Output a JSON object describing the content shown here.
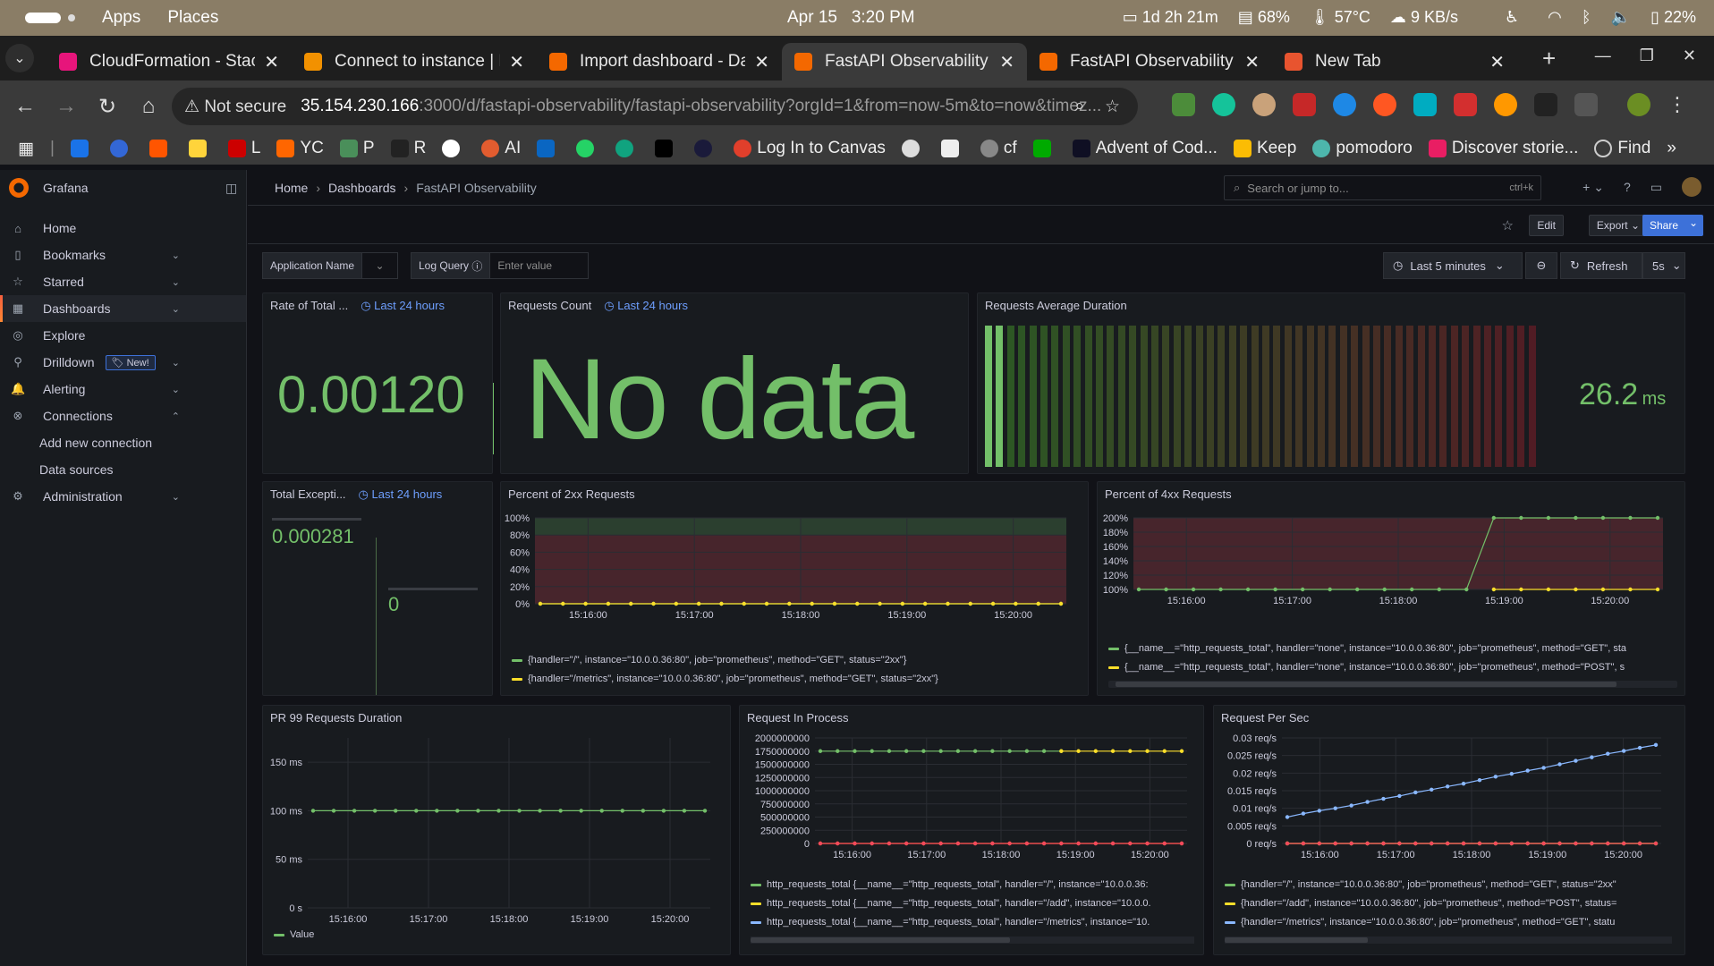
{
  "os": {
    "apps": "Apps",
    "places": "Places",
    "date": "Apr 15",
    "time": "3:20 PM",
    "uptime": "1d 2h 21m",
    "mem": "68%",
    "temp": "57°C",
    "net": "9 KB/s",
    "battery": "22%"
  },
  "browser": {
    "tabs": [
      {
        "title": "CloudFormation - Stac",
        "color": "#e7157b"
      },
      {
        "title": "Connect to instance | E",
        "color": "#f29100"
      },
      {
        "title": "Import dashboard - Da",
        "color": "#f46800"
      },
      {
        "title": "FastAPI Observability",
        "color": "#f46800",
        "active": true
      },
      {
        "title": "FastAPI Observability",
        "color": "#f46800"
      },
      {
        "title": "New Tab",
        "color": "#e8542f"
      }
    ],
    "not_secure": "Not secure",
    "url_host": "35.154.230.166",
    "url_rest": ":3000/d/fastapi-observability/fastapi-observability?orgId=1&from=now-5m&to=now&timez...",
    "bookmarks": [
      "L",
      "YC",
      "P",
      "R",
      "AI",
      "Log In to Canvas",
      "cf",
      "Advent of Cod...",
      "Keep",
      "pomodoro",
      "Discover storie...",
      "Find"
    ]
  },
  "grafana": {
    "app_name": "Grafana",
    "nav": {
      "home": "Home",
      "bookmarks": "Bookmarks",
      "starred": "Starred",
      "dashboards": "Dashboards",
      "explore": "Explore",
      "drilldown": "Drilldown",
      "new_badge": "New!",
      "alerting": "Alerting",
      "connections": "Connections",
      "add_new_connection": "Add new connection",
      "data_sources": "Data sources",
      "administration": "Administration"
    },
    "breadcrumb": {
      "home": "Home",
      "dashboards": "Dashboards",
      "current": "FastAPI Observability"
    },
    "search_placeholder": "Search or jump to...",
    "search_shortcut": "ctrl+k",
    "actions": {
      "edit": "Edit",
      "export": "Export",
      "share": "Share"
    },
    "vars": {
      "app_name_label": "Application Name",
      "log_query_label": "Log Query",
      "log_query_placeholder": "Enter value"
    },
    "time_picker": "Last 5 minutes",
    "refresh": "Refresh",
    "refresh_interval": "5s"
  },
  "panels": {
    "rate_total": {
      "title": "Rate of Total ...",
      "time": "Last 24 hours",
      "value": "0.00120"
    },
    "requests_count": {
      "title": "Requests Count",
      "time": "Last 24 hours",
      "value": "No data"
    },
    "avg_duration": {
      "title": "Requests Average Duration",
      "value": "26.2",
      "unit": "ms"
    },
    "total_exceptions": {
      "title": "Total Excepti...",
      "time": "Last 24 hours",
      "value_a": "0.000281",
      "value_b": "0"
    },
    "pct_2xx": {
      "title": "Percent of 2xx Requests",
      "legend": [
        "{handler=\"/\", instance=\"10.0.0.36:80\", job=\"prometheus\", method=\"GET\", status=\"2xx\"}",
        "{handler=\"/metrics\", instance=\"10.0.0.36:80\", job=\"prometheus\", method=\"GET\", status=\"2xx\"}"
      ]
    },
    "pct_4xx": {
      "title": "Percent of 4xx Requests",
      "legend": [
        "{__name__=\"http_requests_total\", handler=\"none\", instance=\"10.0.0.36:80\", job=\"prometheus\", method=\"GET\", sta",
        "{__name__=\"http_requests_total\", handler=\"none\", instance=\"10.0.0.36:80\", job=\"prometheus\", method=\"POST\", s"
      ]
    },
    "pr99": {
      "title": "PR 99 Requests Duration",
      "legend": [
        "Value"
      ]
    },
    "in_process": {
      "title": "Request In Process",
      "legend": [
        "http_requests_total {__name__=\"http_requests_total\", handler=\"/\", instance=\"10.0.0.36:",
        "http_requests_total {__name__=\"http_requests_total\", handler=\"/add\", instance=\"10.0.0.",
        "http_requests_total {__name__=\"http_requests_total\", handler=\"/metrics\", instance=\"10."
      ]
    },
    "req_per_sec": {
      "title": "Request Per Sec",
      "legend": [
        "{handler=\"/\", instance=\"10.0.0.36:80\", job=\"prometheus\", method=\"GET\", status=\"2xx\"",
        "{handler=\"/add\", instance=\"10.0.0.36:80\", job=\"prometheus\", method=\"POST\", status=",
        "{handler=\"/metrics\", instance=\"10.0.0.36:80\", job=\"prometheus\", method=\"GET\", statu"
      ]
    }
  },
  "chart_data": [
    {
      "type": "line",
      "panel": "pct_2xx",
      "ylim": [
        0,
        100
      ],
      "yticks": [
        "0%",
        "20%",
        "40%",
        "60%",
        "80%",
        "100%"
      ],
      "xticks": [
        "15:16:00",
        "15:17:00",
        "15:18:00",
        "15:19:00",
        "15:20:00"
      ],
      "series": [
        {
          "color": "#73bf69",
          "values": [
            0,
            0,
            0,
            0,
            0,
            0,
            0,
            0,
            0,
            0,
            0,
            0,
            0,
            0,
            0,
            0,
            0,
            0,
            0,
            0,
            0,
            0,
            0,
            0
          ]
        },
        {
          "color": "#fade2a",
          "values": [
            0,
            0,
            0,
            0,
            0,
            0,
            0,
            0,
            0,
            0,
            0,
            0,
            0,
            0,
            0,
            0,
            0,
            0,
            0,
            0,
            0,
            0,
            0,
            0
          ]
        }
      ]
    },
    {
      "type": "line",
      "panel": "pct_4xx",
      "ylim": [
        100,
        200
      ],
      "yticks": [
        "100%",
        "120%",
        "140%",
        "160%",
        "180%",
        "200%"
      ],
      "xticks": [
        "15:16:00",
        "15:17:00",
        "15:18:00",
        "15:19:00",
        "15:20:00"
      ],
      "series": [
        {
          "color": "#73bf69",
          "values": [
            100,
            100,
            100,
            100,
            100,
            100,
            100,
            100,
            100,
            100,
            100,
            100,
            100,
            200,
            200,
            200,
            200,
            200,
            200,
            200
          ]
        },
        {
          "color": "#fade2a",
          "values": [
            null,
            null,
            null,
            null,
            null,
            null,
            null,
            null,
            null,
            null,
            null,
            null,
            null,
            100,
            100,
            100,
            100,
            100,
            100,
            100
          ]
        }
      ]
    },
    {
      "type": "line",
      "panel": "pr99",
      "ylim": [
        0,
        175
      ],
      "yticks": [
        "0 s",
        "50 ms",
        "100 ms",
        "150 ms"
      ],
      "xticks": [
        "15:16:00",
        "15:17:00",
        "15:18:00",
        "15:19:00",
        "15:20:00"
      ],
      "series": [
        {
          "name": "Value",
          "color": "#73bf69",
          "values": [
            100,
            100,
            100,
            100,
            100,
            100,
            100,
            100,
            100,
            100,
            100,
            100,
            100,
            100,
            100,
            100,
            100,
            100,
            100,
            100
          ]
        }
      ]
    },
    {
      "type": "line",
      "panel": "in_process",
      "ylim": [
        0,
        2000000000
      ],
      "yticks": [
        "0",
        "250000000",
        "500000000",
        "750000000",
        "1000000000",
        "1250000000",
        "1500000000",
        "1750000000",
        "2000000000"
      ],
      "xticks": [
        "15:16:00",
        "15:17:00",
        "15:18:00",
        "15:19:00",
        "15:20:00"
      ],
      "series": [
        {
          "color": "#73bf69",
          "values": [
            1750000000,
            1750000000,
            1750000000,
            1750000000,
            1750000000,
            1750000000,
            1750000000,
            1750000000,
            1750000000,
            1750000000,
            1750000000,
            1750000000,
            1750000000,
            1750000000,
            1750000000,
            null,
            null,
            null,
            null,
            null,
            null,
            null
          ]
        },
        {
          "color": "#fade2a",
          "values": [
            null,
            null,
            null,
            null,
            null,
            null,
            null,
            null,
            null,
            null,
            null,
            null,
            null,
            null,
            1750000000,
            1750000000,
            1750000000,
            1750000000,
            1750000000,
            1750000000,
            1750000000,
            1750000000
          ]
        },
        {
          "color": "#ff780a",
          "values": [
            0,
            0,
            0,
            0,
            0,
            0,
            0,
            0,
            0,
            0,
            0,
            0,
            0,
            0,
            0,
            0,
            0,
            0,
            0,
            0,
            0,
            0
          ]
        },
        {
          "color": "#f2495c",
          "values": [
            0,
            0,
            0,
            0,
            0,
            0,
            0,
            0,
            0,
            0,
            0,
            0,
            0,
            0,
            0,
            0,
            0,
            0,
            0,
            0,
            0,
            0
          ]
        }
      ]
    },
    {
      "type": "line",
      "panel": "req_per_sec",
      "ylim": [
        0,
        0.03
      ],
      "yticks": [
        "0 req/s",
        "0.005 req/s",
        "0.01 req/s",
        "0.015 req/s",
        "0.02 req/s",
        "0.025 req/s",
        "0.03 req/s"
      ],
      "xticks": [
        "15:16:00",
        "15:17:00",
        "15:18:00",
        "15:19:00",
        "15:20:00"
      ],
      "series": [
        {
          "color": "#8ab8ff",
          "values": [
            0.0075,
            0.0085,
            0.0093,
            0.01,
            0.0108,
            0.0118,
            0.0127,
            0.0135,
            0.0145,
            0.0153,
            0.0162,
            0.017,
            0.018,
            0.019,
            0.0198,
            0.0207,
            0.0215,
            0.0225,
            0.0235,
            0.0245,
            0.0255,
            0.0263,
            0.0272,
            0.028
          ]
        },
        {
          "color": "#73bf69",
          "values": [
            0,
            0,
            0,
            0,
            0,
            0,
            0,
            0,
            0,
            0,
            0,
            0,
            0,
            0,
            0,
            0,
            0,
            0,
            0,
            0,
            0,
            0,
            0,
            0
          ]
        },
        {
          "color": "#fade2a",
          "values": [
            0,
            0,
            0,
            0,
            0,
            0,
            0,
            0,
            0,
            0,
            0,
            0,
            0,
            0,
            0,
            0,
            0,
            0,
            0,
            0,
            0,
            0,
            0,
            0
          ]
        },
        {
          "color": "#f2495c",
          "values": [
            0,
            0,
            0,
            0,
            0,
            0,
            0,
            0,
            0,
            0,
            0,
            0,
            0,
            0,
            0,
            0,
            0,
            0,
            0,
            0,
            0,
            0,
            0,
            0
          ]
        }
      ]
    }
  ]
}
